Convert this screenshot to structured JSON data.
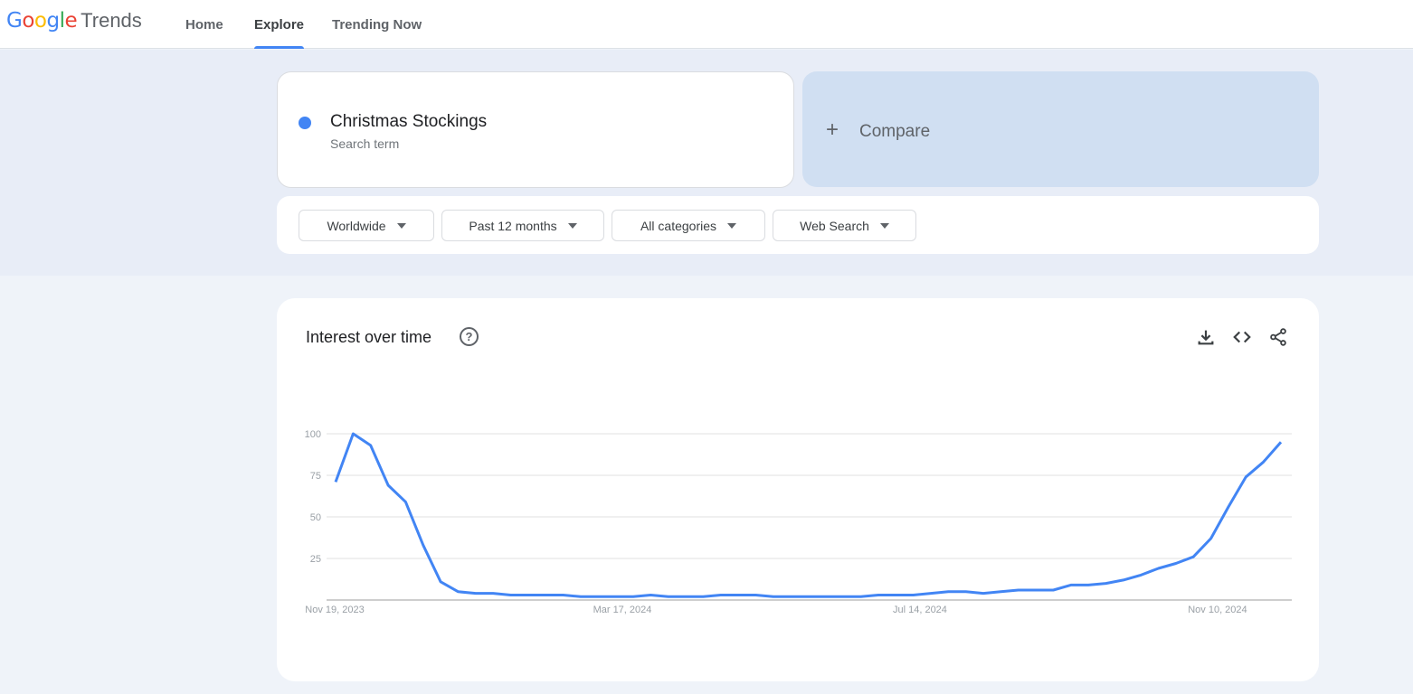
{
  "header": {
    "logo_google": [
      "G",
      "o",
      "o",
      "g",
      "l",
      "e"
    ],
    "logo_product": "Trends",
    "nav": [
      {
        "label": "Home",
        "active": false
      },
      {
        "label": "Explore",
        "active": true
      },
      {
        "label": "Trending Now",
        "active": false
      }
    ]
  },
  "search_term": {
    "name": "Christmas Stockings",
    "type": "Search term",
    "color": "#4285f4"
  },
  "compare": {
    "icon": "plus-icon",
    "label": "Compare"
  },
  "filters": [
    {
      "label": "Worldwide"
    },
    {
      "label": "Past 12 months"
    },
    {
      "label": "All categories"
    },
    {
      "label": "Web Search"
    }
  ],
  "chart_panel": {
    "title": "Interest over time",
    "help_icon": "?",
    "actions": [
      "download-icon",
      "embed-icon",
      "share-icon"
    ]
  },
  "chart_data": {
    "type": "line",
    "title": "Interest over time",
    "xlabel": "",
    "ylabel": "",
    "ylim": [
      0,
      100
    ],
    "yticks": [
      25,
      50,
      75,
      100
    ],
    "grid": true,
    "x_start": "Nov 19, 2023",
    "x_end": "Nov 17, 2024",
    "interval": "weekly",
    "xtick_labels": [
      {
        "index": 0,
        "label": "Nov 19, 2023"
      },
      {
        "index": 17,
        "label": "Mar 17, 2024"
      },
      {
        "index": 34,
        "label": "Jul 14, 2024"
      },
      {
        "index": 51,
        "label": "Nov 10, 2024"
      }
    ],
    "series": [
      {
        "name": "Christmas Stockings",
        "color": "#4285f4",
        "values": [
          71,
          100,
          93,
          69,
          59,
          33,
          11,
          5,
          4,
          4,
          3,
          3,
          3,
          3,
          2,
          2,
          2,
          2,
          3,
          2,
          2,
          2,
          3,
          3,
          3,
          2,
          2,
          2,
          2,
          2,
          2,
          3,
          3,
          3,
          4,
          5,
          5,
          4,
          5,
          6,
          6,
          6,
          9,
          9,
          10,
          12,
          15,
          19,
          22,
          26,
          37,
          56,
          74,
          83,
          95
        ]
      }
    ]
  }
}
